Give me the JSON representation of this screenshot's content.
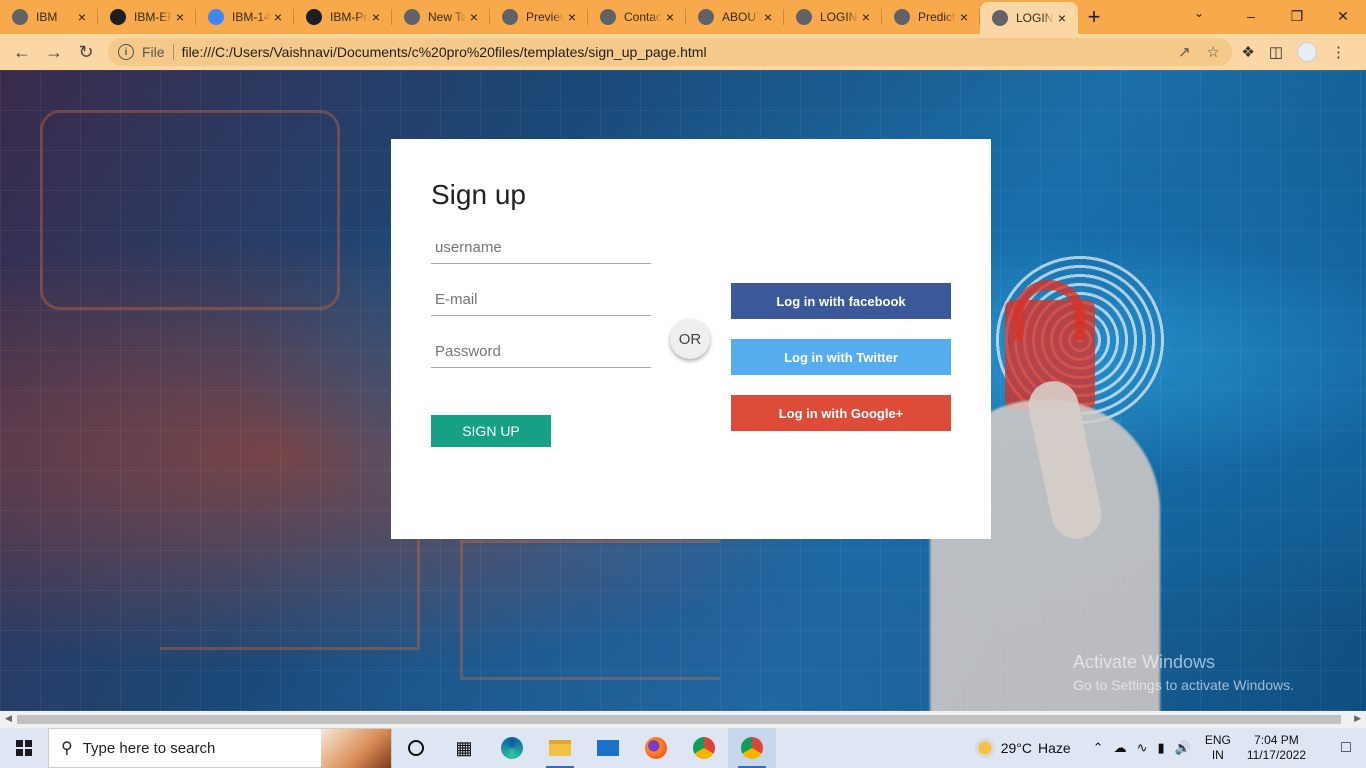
{
  "browser": {
    "tabs": [
      {
        "title": "IBM",
        "icon": "globe-icon",
        "icon_color": "#5f6368"
      },
      {
        "title": "IBM-EPBL",
        "icon": "github-icon",
        "icon_color": "#1b1f23"
      },
      {
        "title": "IBM-14",
        "icon": "docs-icon",
        "icon_color": "#4285f4"
      },
      {
        "title": "IBM-Proj",
        "icon": "github-icon",
        "icon_color": "#1b1f23"
      },
      {
        "title": "New Tab",
        "icon": "chrome-icon",
        "icon_color": "#5f6368"
      },
      {
        "title": "Preview",
        "icon": "globe-icon",
        "icon_color": "#5f6368"
      },
      {
        "title": "Contact",
        "icon": "globe-icon",
        "icon_color": "#5f6368"
      },
      {
        "title": "ABOUT",
        "icon": "globe-icon",
        "icon_color": "#5f6368"
      },
      {
        "title": "LOGIN",
        "icon": "globe-icon",
        "icon_color": "#5f6368"
      },
      {
        "title": "Predict",
        "icon": "globe-icon",
        "icon_color": "#5f6368"
      },
      {
        "title": "LOGIN",
        "icon": "globe-icon",
        "icon_color": "#5f6368",
        "active": true
      }
    ],
    "new_tab_label": "+",
    "close_glyph": "×",
    "address": {
      "scheme_label": "File",
      "url": "file:///C:/Users/Vaishnavi/Documents/c%20pro%20files/templates/sign_up_page.html"
    },
    "chrome_color": "#f7a94b",
    "toolbar_color": "#fbd7a5"
  },
  "signup": {
    "title": "Sign up",
    "username_placeholder": "username",
    "email_placeholder": "E-mail",
    "password_placeholder": "Password",
    "submit_label": "SIGN UP",
    "submit_color": "#16a085",
    "or_label": "OR",
    "social": [
      {
        "label": "Log in with facebook",
        "color": "#3b5998"
      },
      {
        "label": "Log in with Twitter",
        "color": "#55acee"
      },
      {
        "label": "Log in with Google+",
        "color": "#dd4b39"
      }
    ]
  },
  "watermark": {
    "line1": "Activate Windows",
    "line2": "Go to Settings to activate Windows."
  },
  "taskbar": {
    "search_placeholder": "Type here to search",
    "apps": [
      "cortana-icon",
      "task-view-icon",
      "edge-icon",
      "file-explorer-icon",
      "mail-icon",
      "firefox-icon",
      "chrome-icon",
      "chrome-canary-icon"
    ],
    "weather": {
      "temp": "29°C",
      "condition": "Haze"
    },
    "lang": {
      "line1": "ENG",
      "line2": "IN"
    },
    "clock": {
      "time": "7:04 PM",
      "date": "11/17/2022"
    }
  }
}
